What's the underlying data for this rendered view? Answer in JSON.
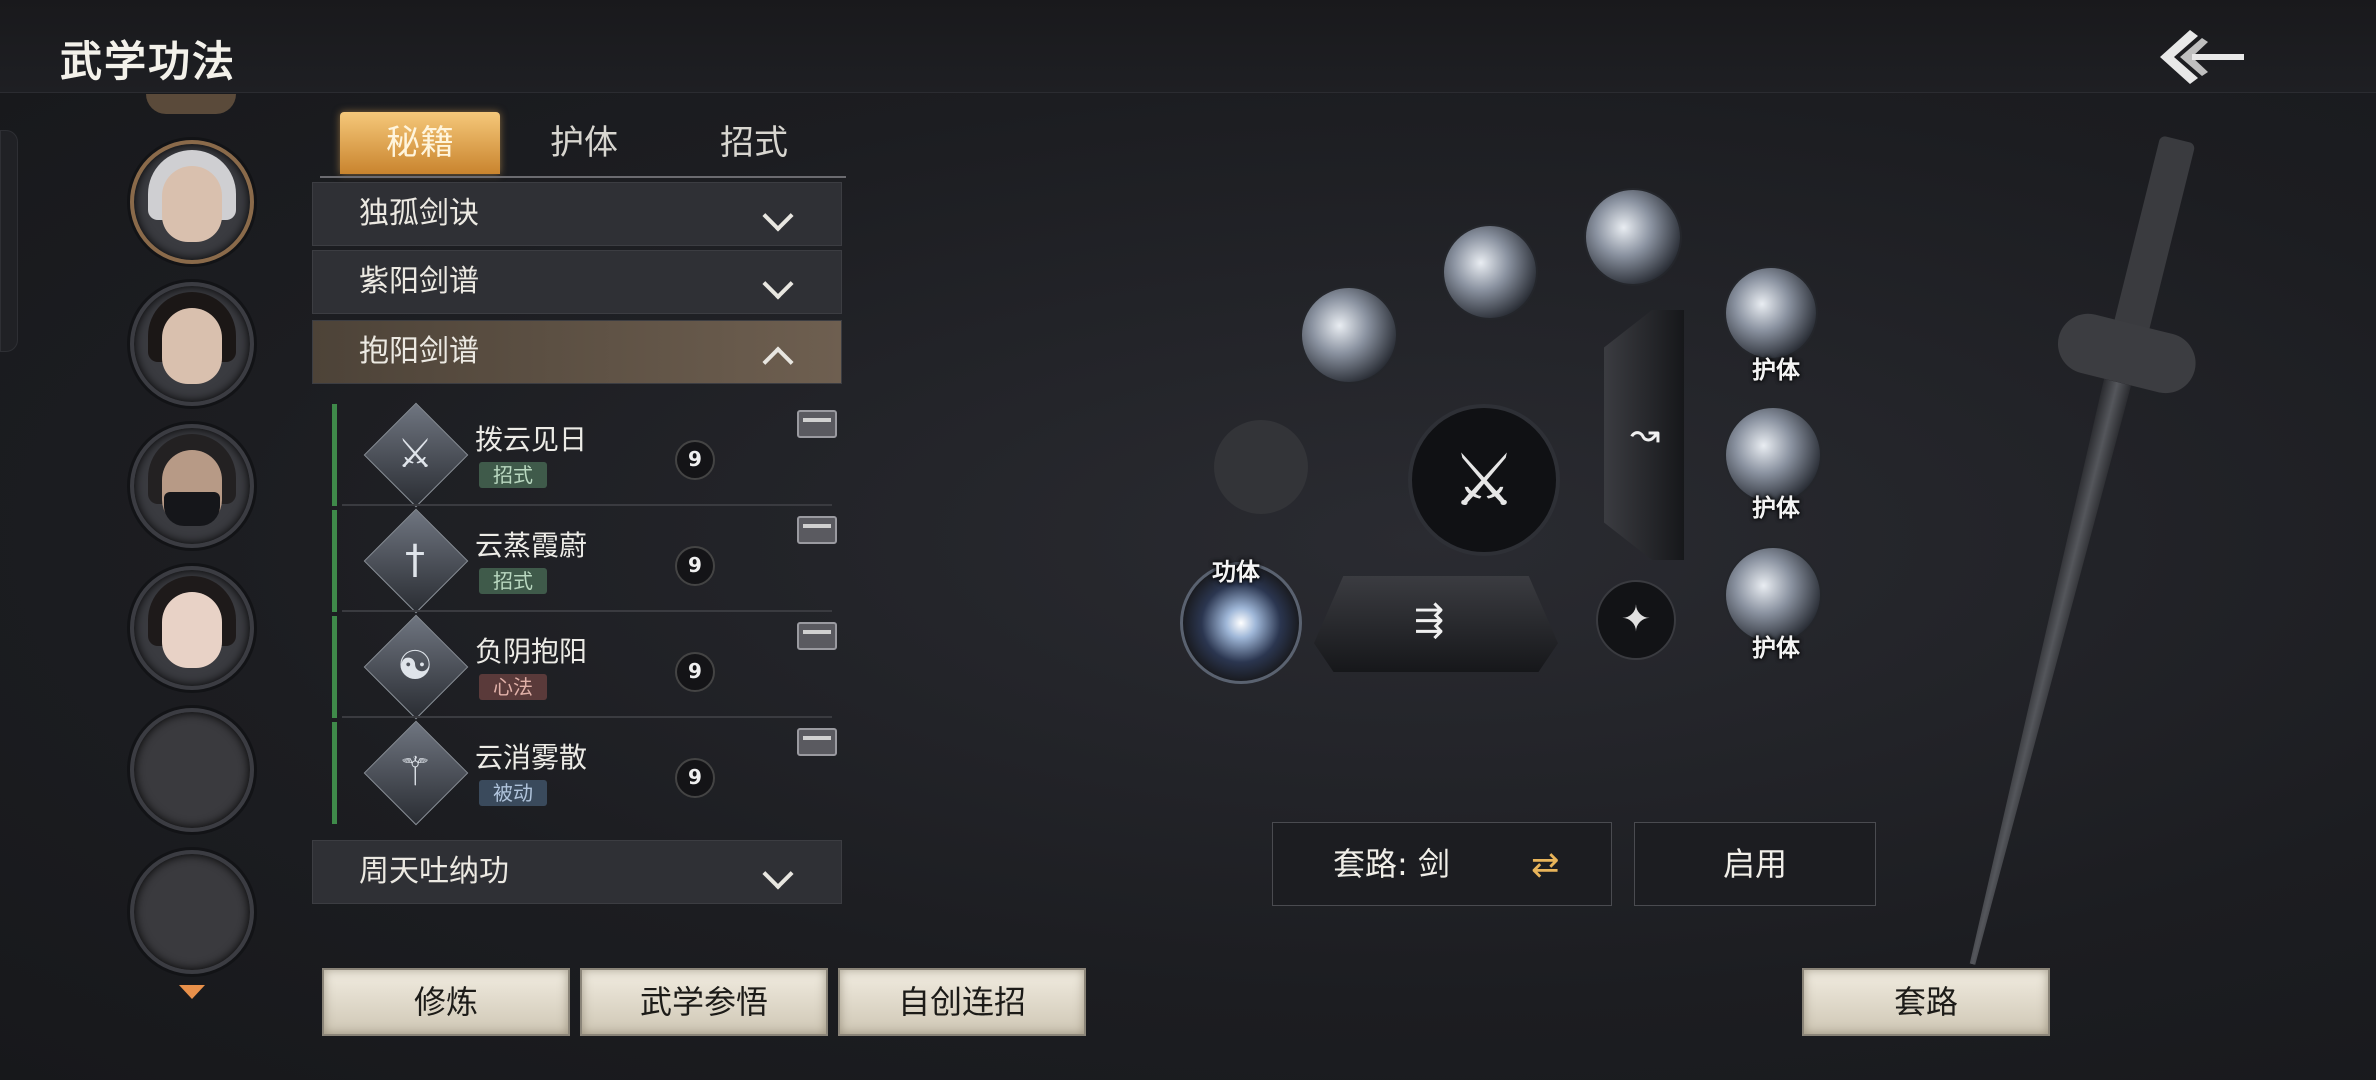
{
  "header": {
    "title": "武学功法"
  },
  "tabs": [
    {
      "label": "秘籍",
      "active": true
    },
    {
      "label": "护体",
      "active": false
    },
    {
      "label": "招式",
      "active": false
    }
  ],
  "sections": [
    {
      "label": "独孤剑诀",
      "expanded": false
    },
    {
      "label": "紫阳剑谱",
      "expanded": false
    },
    {
      "label": "抱阳剑谱",
      "expanded": true
    },
    {
      "label": "周天吐纳功",
      "expanded": false
    }
  ],
  "skills": [
    {
      "name": "拨云见日",
      "tag": "招式",
      "level": "9",
      "icon": "sword-glyph-icon"
    },
    {
      "name": "云蒸霞蔚",
      "tag": "招式",
      "level": "9",
      "icon": "sword-glyph-icon"
    },
    {
      "name": "负阴抱阳",
      "tag": "心法",
      "level": "9",
      "icon": "yin-yang-glyph-icon"
    },
    {
      "name": "云消雾散",
      "tag": "被动",
      "level": "9",
      "icon": "sword-glyph-icon"
    }
  ],
  "wheel": {
    "orb_labels": [
      "护体",
      "护体",
      "护体",
      "功体"
    ]
  },
  "routine": {
    "label": "套路: 剑",
    "enable": "启用"
  },
  "buttons": {
    "train": "修炼",
    "insight": "武学参悟",
    "combo": "自创连招",
    "routine": "套路"
  },
  "colors": {
    "accent": "#e0a04a",
    "tab_active": "#d9953e",
    "skill_bar": "#3f8a4a"
  }
}
